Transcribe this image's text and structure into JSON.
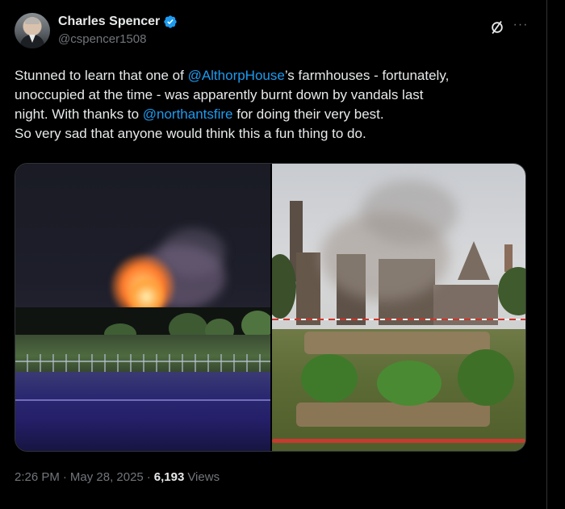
{
  "tweet": {
    "author": {
      "display_name": "Charles Spencer",
      "handle": "@cspencer1508",
      "verified": true,
      "avatar_icon": "profile-photo"
    },
    "body": {
      "line1_pre": "Stunned to learn that one of ",
      "line1_mention": "@AlthorpHouse",
      "line1_post": "’s farmhouses - fortunately,",
      "line2": "unoccupied at the time - was apparently burnt down by vandals last",
      "line3_pre": "night. With thanks to ",
      "line3_mention": "@northantsfire",
      "line3_post": " for doing their very best.",
      "line4": "So very sad that anyone would think this a fun thing to do."
    },
    "media": [
      {
        "kind": "photo",
        "subject": "night-fire"
      },
      {
        "kind": "photo",
        "subject": "burnt-ruins"
      }
    ],
    "time": "2:26 PM",
    "separator": "·",
    "date": "May 28, 2025",
    "views_count": "6,193",
    "views_label": "Views"
  },
  "icons": {
    "verified": "verified-badge-icon",
    "grok": "grok-icon",
    "more": "more-options-icon"
  },
  "colors": {
    "background": "#000000",
    "text": "#e7e9ea",
    "secondary_text": "#71767b",
    "link": "#1d9bf0",
    "verified": "#1d9bf0",
    "border": "#2f3336"
  }
}
